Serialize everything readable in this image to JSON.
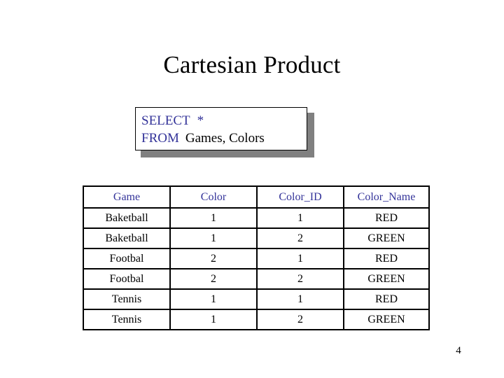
{
  "slide": {
    "title": "Cartesian Product",
    "page_number": "4",
    "background_color": "#ffffff"
  },
  "sql_box": {
    "keyword_color": "#333399",
    "body_color": "#000000",
    "shadow_color": "#808080",
    "line1_keyword": "SELECT",
    "line1_star": "*",
    "line2_keyword": "FROM",
    "line2_tables": "Games, Colors"
  },
  "result_table": {
    "header_color": "#333399",
    "columns": [
      "Game",
      "Color",
      "Color_ID",
      "Color_Name"
    ],
    "rows": [
      {
        "game": "Baketball",
        "color": "1",
        "color_id": "1",
        "color_name": "RED",
        "color_name_hex": "#CC3333"
      },
      {
        "game": "Baketball",
        "color": "1",
        "color_id": "2",
        "color_name": "GREEN",
        "color_name_hex": "#2E9B5E"
      },
      {
        "game": "Footbal",
        "color": "2",
        "color_id": "1",
        "color_name": "RED",
        "color_name_hex": "#CC3333"
      },
      {
        "game": "Footbal",
        "color": "2",
        "color_id": "2",
        "color_name": "GREEN",
        "color_name_hex": "#2E9B5E"
      },
      {
        "game": "Tennis",
        "color": "1",
        "color_id": "1",
        "color_name": "RED",
        "color_name_hex": "#CC3333"
      },
      {
        "game": "Tennis",
        "color": "1",
        "color_id": "2",
        "color_name": "GREEN",
        "color_name_hex": "#2E9B5E"
      }
    ]
  }
}
